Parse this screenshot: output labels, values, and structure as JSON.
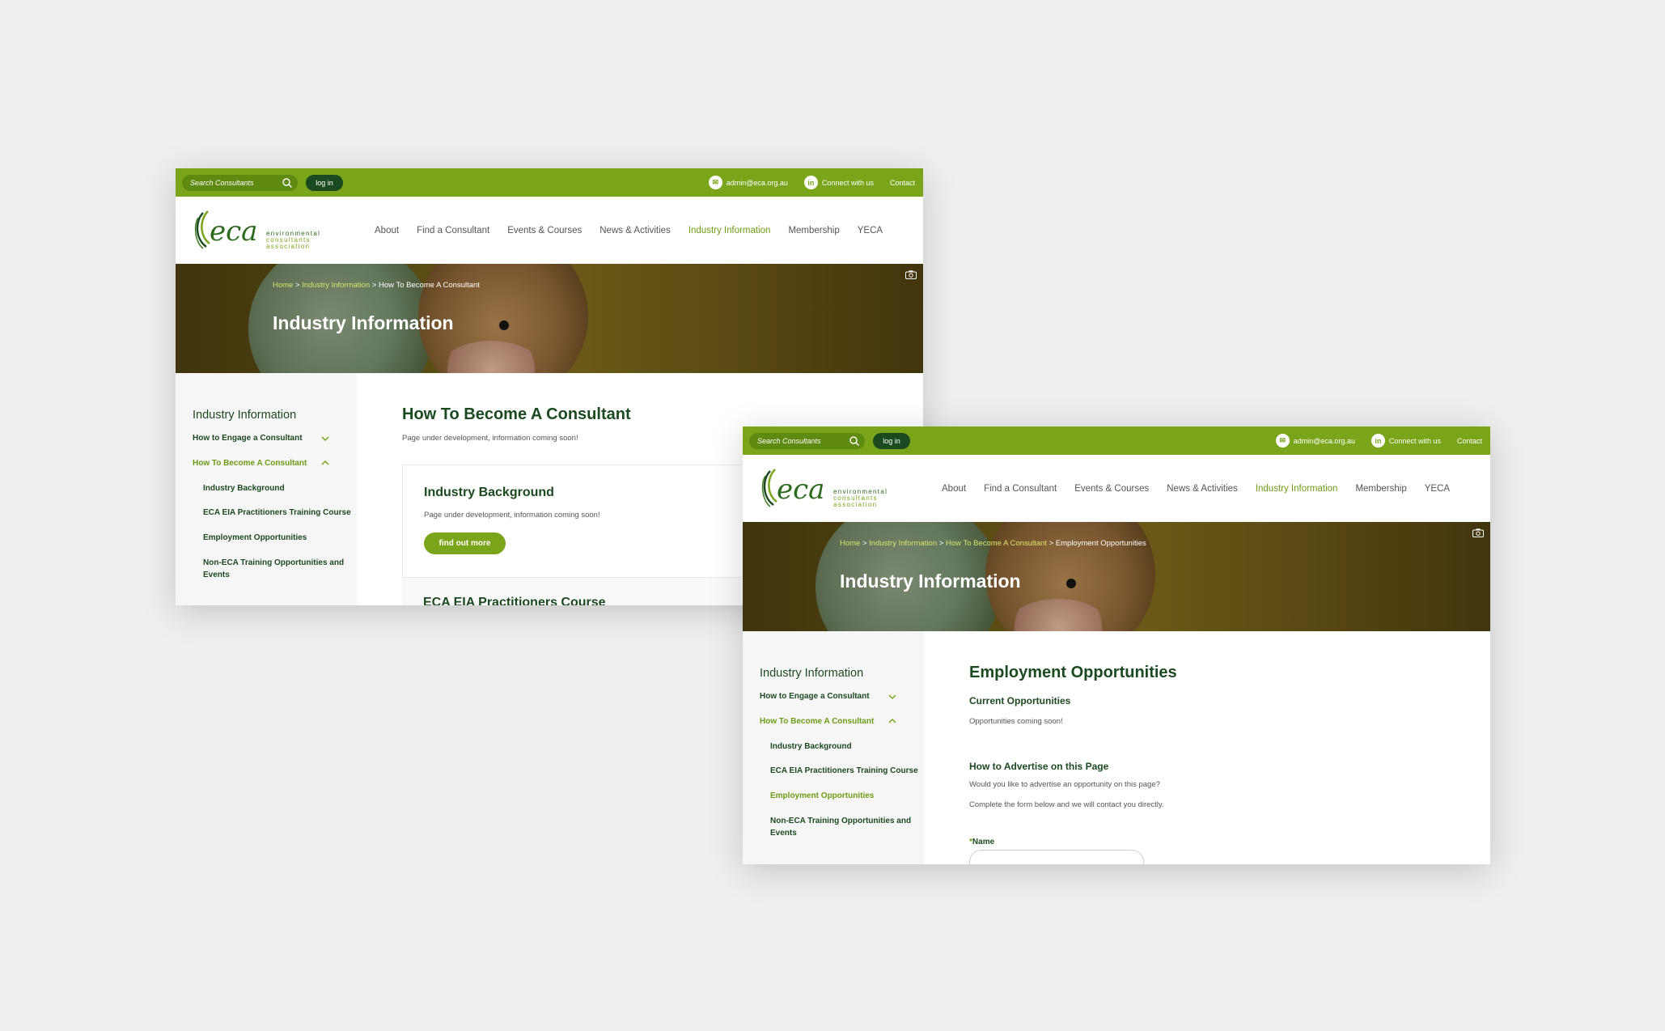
{
  "topbar": {
    "search_placeholder": "Search Consultants",
    "login_label": "log in",
    "email": "admin@eca.org.au",
    "connect": "Connect with us",
    "contact": "Contact"
  },
  "logo": {
    "mark": "eca",
    "line1": "environmental",
    "line2": "consultants",
    "line3": "association"
  },
  "nav": [
    "About",
    "Find a Consultant",
    "Events & Courses",
    "News & Activities",
    "Industry Information",
    "Membership",
    "YECA"
  ],
  "colors": {
    "brand_green": "#7aa51b",
    "dark_green": "#1c4a20",
    "accent_green": "#6e9b16"
  },
  "sidebar": {
    "title": "Industry Information",
    "items": [
      {
        "label": "How to Engage a Consultant"
      },
      {
        "label": "How To Become A Consultant"
      },
      {
        "label": "Industry Background"
      },
      {
        "label": "ECA EIA Practitioners Training Course"
      },
      {
        "label": "Employment Opportunities"
      },
      {
        "label": "Non-ECA Training Opportunities and"
      },
      {
        "label": "Events"
      }
    ]
  },
  "page_a": {
    "breadcrumb": {
      "home": "Home",
      "sep1": " > ",
      "section": "Industry Information",
      "sep2": " > ",
      "current": "How To Become A Consultant"
    },
    "hero_title": "Industry Information",
    "main_title": "How To Become A Consultant",
    "main_desc": "Page under development, information coming soon!",
    "card1": {
      "title": "Industry Background",
      "desc": "Page under development, information coming soon!",
      "button": "find out more"
    },
    "card2": {
      "title": "ECA EIA Practitioners Course"
    }
  },
  "page_b": {
    "breadcrumb": {
      "home": "Home",
      "sep1": " > ",
      "section": "Industry Information",
      "sep2": " > ",
      "parent": "How To Become A Consultant",
      "sep3": " > ",
      "current": "Employment Opportunities"
    },
    "hero_title": "Industry Information",
    "main_title": "Employment Opportunities",
    "current_title": "Current Opportunities",
    "current_text": "Opportunities coming soon!",
    "advertise_title": "How to Advertise on this Page",
    "advertise_text1": "Would you like to advertise an opportunity on this page?",
    "advertise_text2": "Complete the form below and we will contact you directly.",
    "form_required": "*",
    "form_name_label": "Name"
  }
}
